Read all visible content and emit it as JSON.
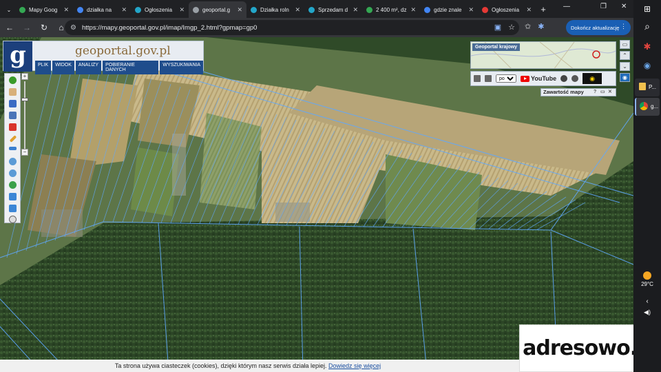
{
  "browser": {
    "tabs": [
      {
        "title": "Mapy Goog",
        "color": "#34a853",
        "active": false
      },
      {
        "title": "działka na",
        "color": "#4285f4",
        "active": false
      },
      {
        "title": "Ogłoszenia",
        "color": "#23a6c9",
        "active": false
      },
      {
        "title": "geoportal.g",
        "color": "#9aa0a6",
        "active": true
      },
      {
        "title": "Działka roln",
        "color": "#23a6c9",
        "active": false
      },
      {
        "title": "Sprzedam d",
        "color": "#23a6c9",
        "active": false
      },
      {
        "title": "2 400 m², dz",
        "color": "#34a853",
        "active": false
      },
      {
        "title": "gdzie znale",
        "color": "#4285f4",
        "active": false
      },
      {
        "title": "Ogłoszenia",
        "color": "#e53935",
        "active": false
      }
    ],
    "new_tab": "+",
    "url": "https://mapy.geoportal.gov.pl/imap/Imgp_2.html?gpmap=gp0",
    "update_button": "Dokończ aktualizację"
  },
  "geoportal": {
    "logo_letter": "g",
    "site_title": "geoportal.gov.pl",
    "menu": [
      "PLIK",
      "WIDOK",
      "ANALIZY",
      "POBIERANIE DANYCH",
      "WYSZUKIWANIA"
    ],
    "overview_label": "Geoportal krajowy",
    "language": "pol",
    "youtube_label": "YouTube",
    "contents_label": "Zawartość mapy",
    "contents_icons": [
      "?",
      "▭",
      "✕"
    ]
  },
  "cookie": {
    "text": "Ta strona używa ciasteczek (cookies), dzięki którym nasz serwis działa lepiej.",
    "link": "Dowiedz się więcej"
  },
  "watermark": "adresowo.pl",
  "taskbar": {
    "temperature": "29°C",
    "app1_label": "P...",
    "app2_label": "g..."
  },
  "colors": {
    "accent_blue": "#1a5fb4",
    "parcel_lines": "#5fa8ff",
    "geoportal_menu": "#1f4d8c"
  }
}
